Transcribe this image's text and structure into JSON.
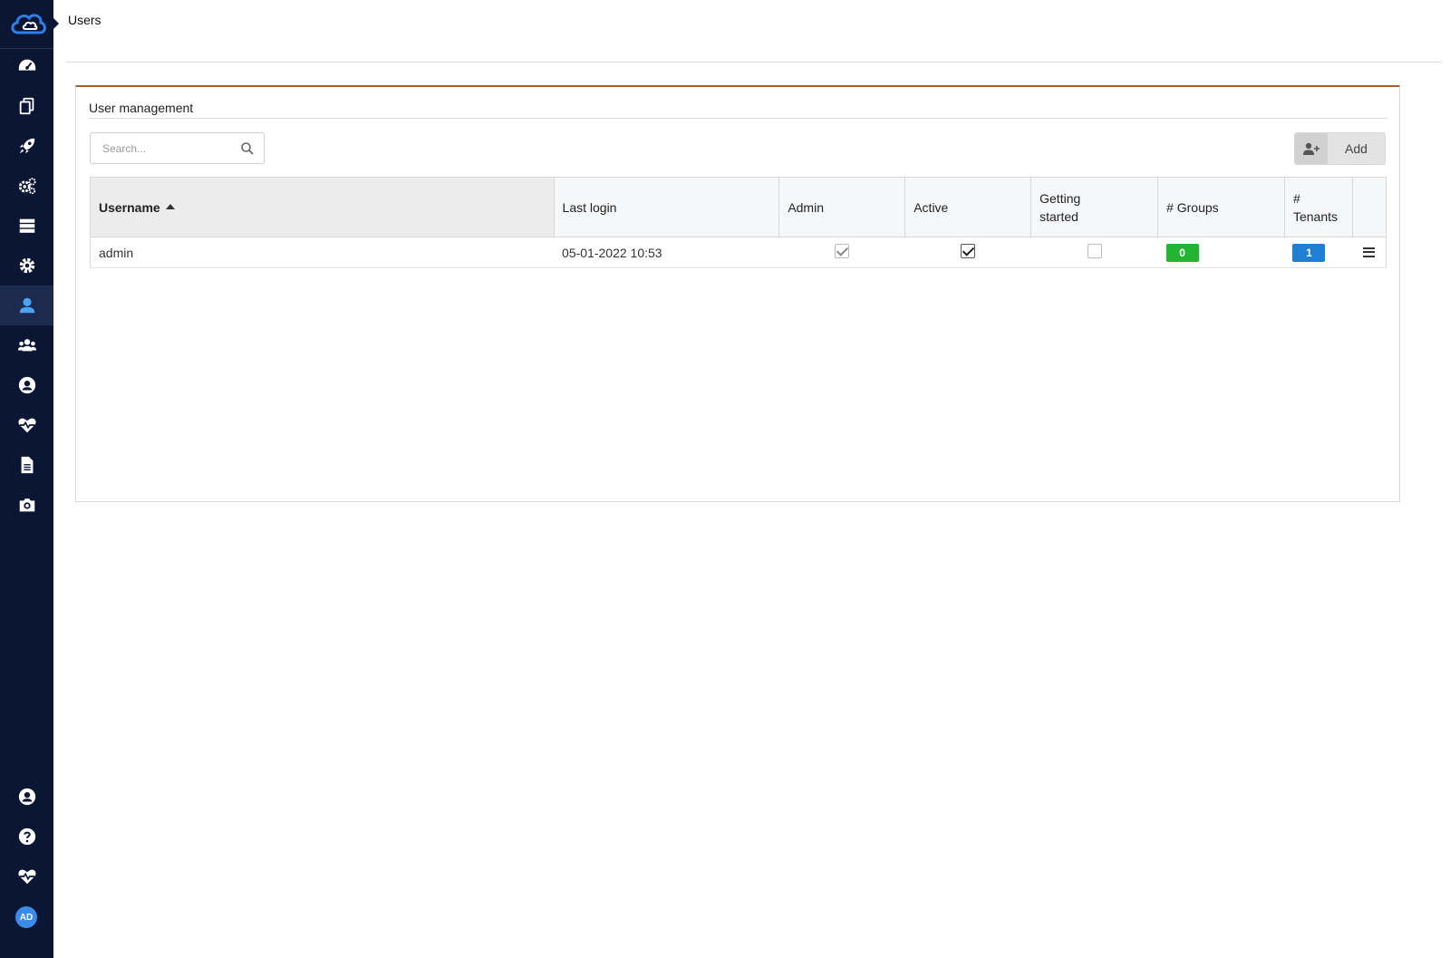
{
  "breadcrumb": {
    "current": "Users"
  },
  "sidebar": {
    "items": [
      {
        "icon": "dashboard-icon"
      },
      {
        "icon": "copy-icon"
      },
      {
        "icon": "rocket-icon"
      },
      {
        "icon": "cogs-icon"
      },
      {
        "icon": "server-icon"
      },
      {
        "icon": "gear-icon"
      },
      {
        "icon": "user-icon",
        "active": true
      },
      {
        "icon": "users-icon"
      },
      {
        "icon": "user-circle-icon"
      },
      {
        "icon": "heartbeat-icon"
      },
      {
        "icon": "document-icon"
      },
      {
        "icon": "camera-icon"
      }
    ],
    "bottom_items": [
      {
        "icon": "user-circle-icon"
      },
      {
        "icon": "help-icon"
      },
      {
        "icon": "heartbeat-icon"
      }
    ],
    "avatar_initials": "AD"
  },
  "panel": {
    "title": "User management",
    "search_placeholder": "Search...",
    "add_label": "Add"
  },
  "table": {
    "columns": [
      "Username",
      "Last login",
      "Admin",
      "Active",
      "Getting started",
      "# Groups",
      "# Tenants"
    ],
    "sorted_column": "Username",
    "rows": [
      {
        "username": "admin",
        "last_login": "05-01-2022 10:53",
        "admin": true,
        "active": true,
        "getting_started": false,
        "groups": "0",
        "tenants": "1"
      }
    ]
  },
  "colors": {
    "sidebar": "#0b1534",
    "accent_border": "#a0622a",
    "groups_badge": "#21b534",
    "tenants_badge": "#1f7fd3",
    "avatar": "#3b8be8"
  }
}
